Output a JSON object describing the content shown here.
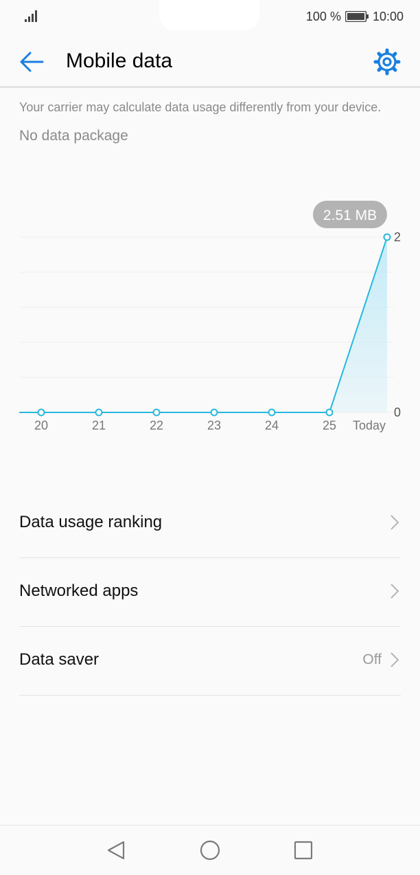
{
  "status_bar": {
    "battery_percent": "100 %",
    "time": "10:00",
    "icons": [
      "signal-icon",
      "battery-icon"
    ]
  },
  "header": {
    "title": "Mobile data",
    "back_icon": "arrow-left-icon",
    "settings_icon": "gear-icon"
  },
  "main": {
    "carrier_note": "Your carrier may calculate data usage differently from your device.",
    "package_status": "No data package"
  },
  "chart_data": {
    "type": "area",
    "categories": [
      "20",
      "21",
      "22",
      "23",
      "24",
      "25",
      "Today"
    ],
    "values": [
      0,
      0,
      0,
      0,
      0,
      0,
      2.51
    ],
    "unit": "MB",
    "ylim": [
      0,
      2
    ],
    "y_ticks": [
      "0",
      "2"
    ],
    "tooltip": "2.51 MB",
    "grid": true,
    "colors": {
      "line": "#27b8de",
      "fill": "#bfe9f7",
      "tooltip_bg": "#b3b3b3",
      "grid": "#eeeeee"
    }
  },
  "menu": {
    "items": [
      {
        "label": "Data usage ranking",
        "value": ""
      },
      {
        "label": "Networked apps",
        "value": ""
      },
      {
        "label": "Data saver",
        "value": "Off"
      }
    ]
  },
  "nav_bar": {
    "icons": [
      "back-triangle-icon",
      "home-circle-icon",
      "recents-square-icon"
    ]
  },
  "colors": {
    "accent": "#1a7fe0",
    "background": "#fafafa"
  }
}
